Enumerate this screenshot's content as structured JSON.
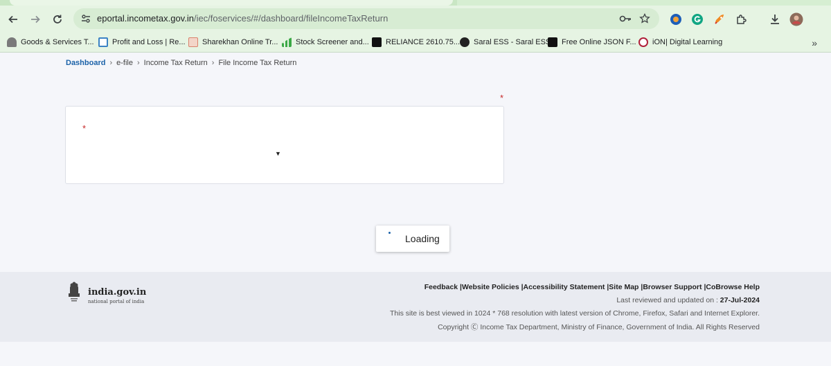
{
  "browser": {
    "url_host": "eportal.incometax.gov.in",
    "url_path": "/iec/foservices/#/dashboard/fileIncomeTaxReturn",
    "bookmarks": [
      {
        "label": "Goods & Services T...",
        "icon": "gst-icon",
        "color": "#7a7a7a"
      },
      {
        "label": "Profit and Loss | Re...",
        "icon": "pl-icon",
        "color": "#3b82c4"
      },
      {
        "label": "Sharekhan Online Tr...",
        "icon": "sharekhan-icon",
        "color": "#d9826b"
      },
      {
        "label": "Stock Screener and...",
        "icon": "chart-bars-icon",
        "color": "#3aa845"
      },
      {
        "label": "RELIANCE 2610.75...",
        "icon": "tv-icon",
        "color": "#111111"
      },
      {
        "label": "Saral ESS - Saral ESS",
        "icon": "globe-icon",
        "color": "#222222"
      },
      {
        "label": "Free Online JSON F...",
        "icon": "ff-icon",
        "color": "#111111"
      },
      {
        "label": "iON| Digital Learning",
        "icon": "ion-icon",
        "color": "#b0203a"
      }
    ]
  },
  "breadcrumb": {
    "items": [
      "Dashboard",
      "e-file",
      "Income Tax Return",
      "File Income Tax Return"
    ]
  },
  "form": {
    "required_mark": "*"
  },
  "loading": {
    "label": "Loading"
  },
  "footer": {
    "gov_title": "india.gov.in",
    "gov_subtitle": "national portal of india",
    "links": [
      "Feedback",
      "Website Policies",
      "Accessibility Statement",
      "Site Map",
      "Browser Support",
      "CoBrowse Help"
    ],
    "last_reviewed_label": "Last reviewed and updated on : ",
    "last_reviewed_date": "27-Jul-2024",
    "best_viewed": "This site is best viewed in 1024 * 768 resolution with latest version of Chrome, Firefox, Safari and Internet Explorer.",
    "copyright": "Copyright Ⓒ Income Tax Department, Ministry of Finance, Government of India. All Rights Reserved"
  }
}
